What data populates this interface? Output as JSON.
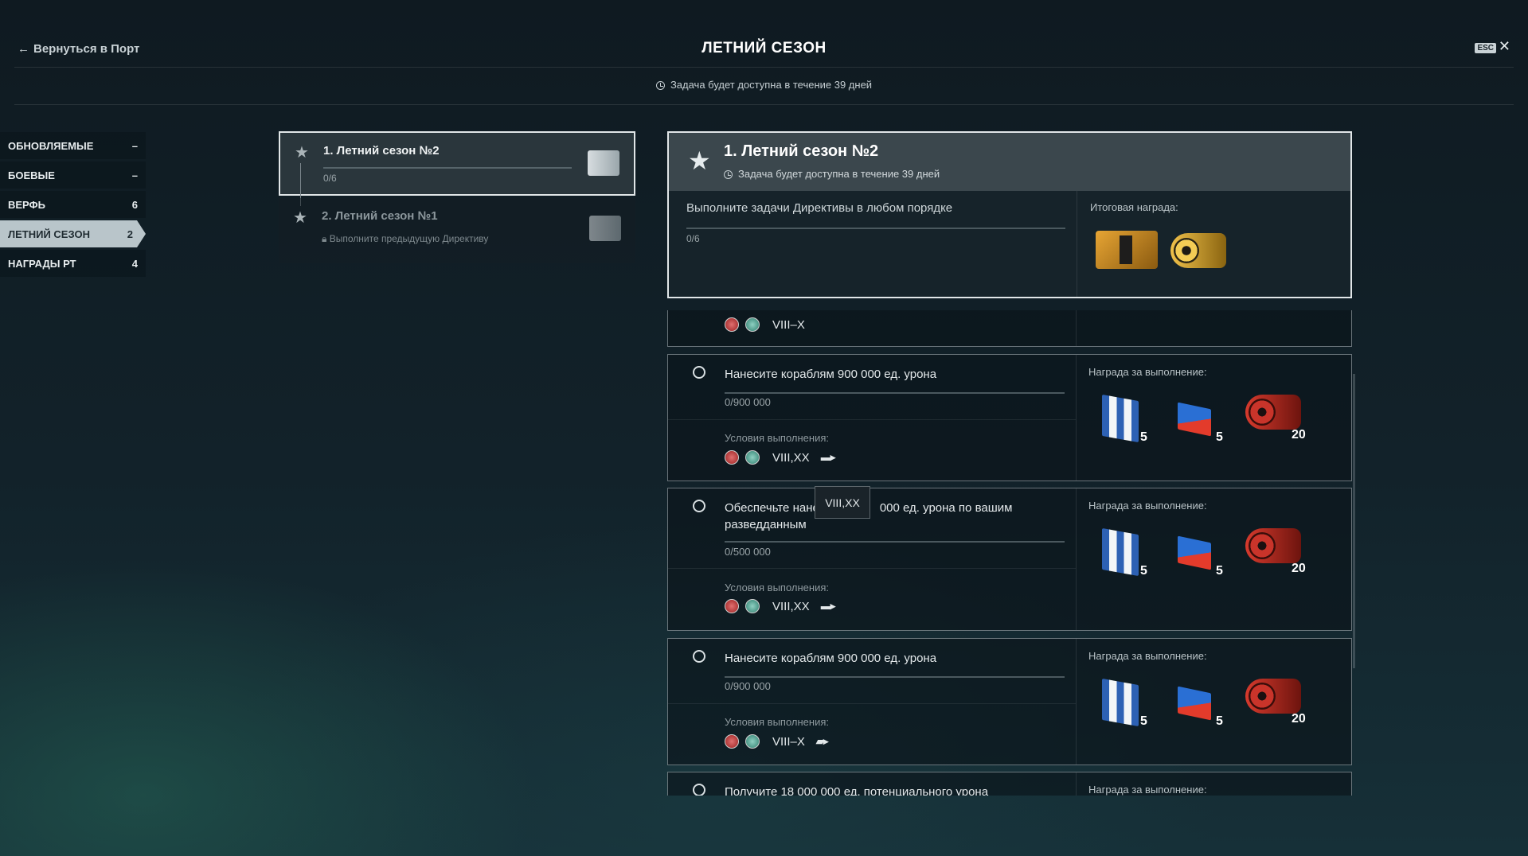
{
  "header": {
    "back_label": "Вернуться в Порт",
    "title": "ЛЕТНИЙ СЕЗОН",
    "availability": "Задача будет доступна в течение 39 дней",
    "esc_label": "ESC"
  },
  "nav": {
    "items": [
      {
        "label": "ОБНОВЛЯЕМЫЕ",
        "count": "–"
      },
      {
        "label": "БОЕВЫЕ",
        "count": "–"
      },
      {
        "label": "ВЕРФЬ",
        "count": "6"
      },
      {
        "label": "ЛЕТНИЙ СЕЗОН",
        "count": "2"
      },
      {
        "label": "НАГРАДЫ РТ",
        "count": "4"
      }
    ]
  },
  "directives": [
    {
      "name": "1. Летний сезон №2",
      "progress": "0/6"
    },
    {
      "name": "2. Летний сезон №1",
      "locked_text": "Выполните предыдущую Директиву"
    }
  ],
  "detail": {
    "name": "1. Летний сезон №2",
    "availability": "Задача будет доступна в течение 39 дней",
    "description": "Выполните задачи Директивы в любом порядке",
    "progress": "0/6",
    "reward_label": "Итоговая награда:"
  },
  "tasks": [
    {
      "conditions_tier": "VIII–X"
    },
    {
      "text": "Нанесите кораблям 900 000 ед. урона",
      "progress": "0/900 000",
      "conditions_label": "Условия выполнения:",
      "tier": "VIII,XX",
      "reward_label": "Награда за выполнение:",
      "rewards": [
        "5",
        "5",
        "20"
      ]
    },
    {
      "text": "Обеспечьте нане",
      "text_tail": "000 ед. урона по вашим",
      "text_line2": "разведданным",
      "progress": "0/500 000",
      "conditions_label": "Условия выполнения:",
      "tier": "VIII,XX",
      "reward_label": "Награда за выполнение:",
      "rewards": [
        "5",
        "5",
        "20"
      ]
    },
    {
      "text": "Нанесите кораблям 900 000 ед. урона",
      "progress": "0/900 000",
      "conditions_label": "Условия выполнения:",
      "tier": "VIII–X",
      "reward_label": "Награда за выполнение:",
      "rewards": [
        "5",
        "5",
        "20"
      ]
    },
    {
      "text": "Получите 18 000 000 ед. потенциального урона",
      "reward_label": "Награда за выполнение:"
    }
  ],
  "tooltip": "VIII,XX",
  "icons": {
    "back": "arrow-left-icon",
    "clock": "clock-icon",
    "star": "star-icon",
    "close": "close-icon"
  }
}
